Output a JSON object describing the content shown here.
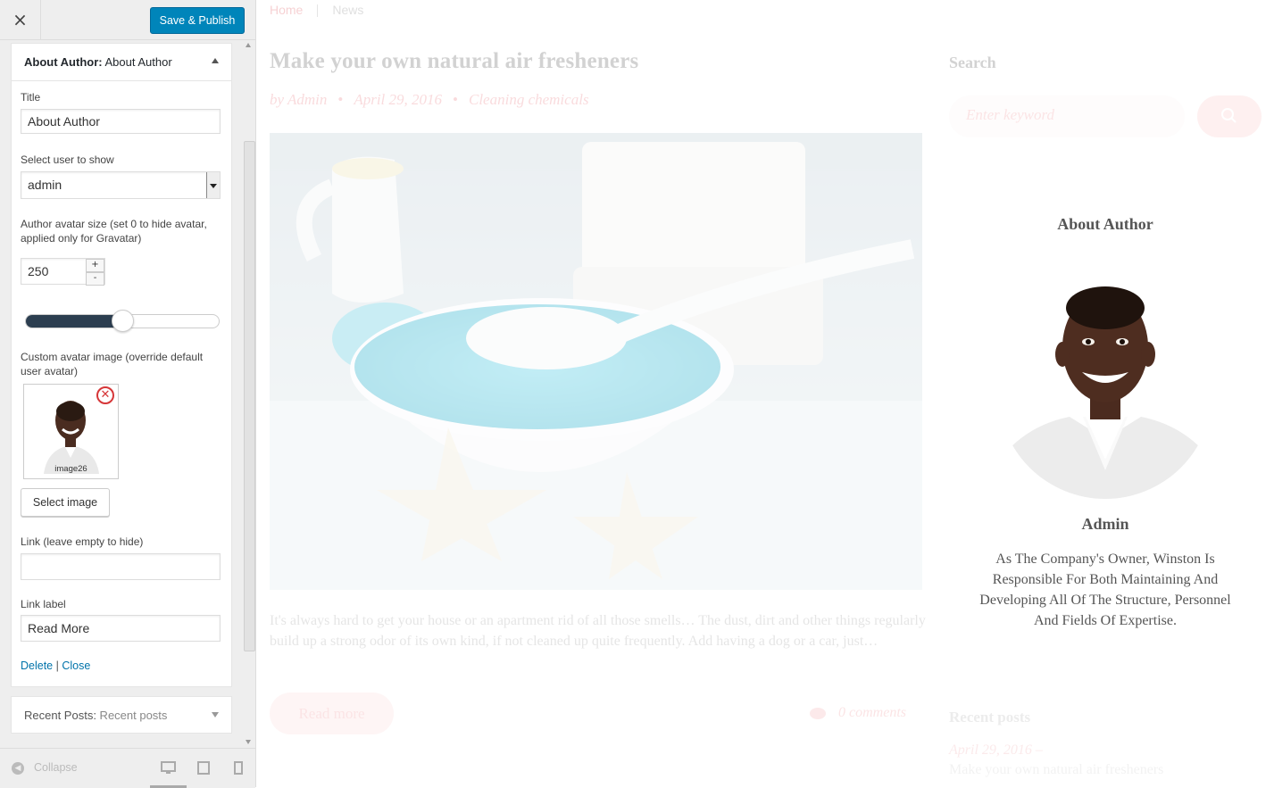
{
  "customizer": {
    "close_icon": "×",
    "publish_label": "Save & Publish",
    "widget": {
      "header_bold": "About Author:",
      "header_name": " About Author",
      "title_label": "Title",
      "title_value": "About Author",
      "user_label": "Select user to show",
      "user_value": "admin",
      "avatar_size_label": "Author avatar size (set 0 to hide avatar, applied only for Gravatar)",
      "avatar_size_value": "250",
      "stepper_plus": "+",
      "stepper_minus": "-",
      "avatar_size_fraction": 0.5,
      "custom_avatar_label": "Custom avatar image (override default user avatar)",
      "avatar_thumb_caption": "image26",
      "select_image_label": "Select image",
      "link_label": "Link (leave empty to hide)",
      "link_value": "",
      "link_label_label": "Link label",
      "link_label_value": "Read More",
      "delete_label": "Delete",
      "separator": " | ",
      "close_label": "Close"
    },
    "recent_widget": {
      "header_bold": "Recent Posts:",
      "header_name": " Recent posts"
    },
    "footer": {
      "collapse_label": "Collapse"
    }
  },
  "preview": {
    "nav": {
      "home": "Home",
      "news": "News"
    },
    "post": {
      "title": "Make your own natural air fresheners",
      "author": "by Admin",
      "date": "April 29, 2016",
      "category": "Cleaning chemicals",
      "dot": "•",
      "excerpt": "It's always hard to get your house or an apartment rid of all those smells… The dust, dirt and other things regularly build up a strong odor of its own kind, if not cleaned up quite frequently. Add having a dog or a car, just…",
      "read_more": "Read more",
      "comments": "0 comments"
    },
    "sidebar": {
      "search_title": "Search",
      "search_placeholder": "Enter keyword",
      "about_title": "About Author",
      "author_name": "Admin",
      "author_bio": "As The Company's Owner, Winston Is Responsible For Both Maintaining And Developing All Of The Structure, Personnel And Fields Of Expertise.",
      "recent_title": "Recent posts",
      "recent_date": "April 29, 2016 –",
      "recent_link": "Make your own natural air fresheners"
    }
  },
  "colors": {
    "publish_button": "#0085ba",
    "accent_pink": "#f4b7b9",
    "link_blue": "#0073aa",
    "slider_fill": "#2c3e50"
  }
}
